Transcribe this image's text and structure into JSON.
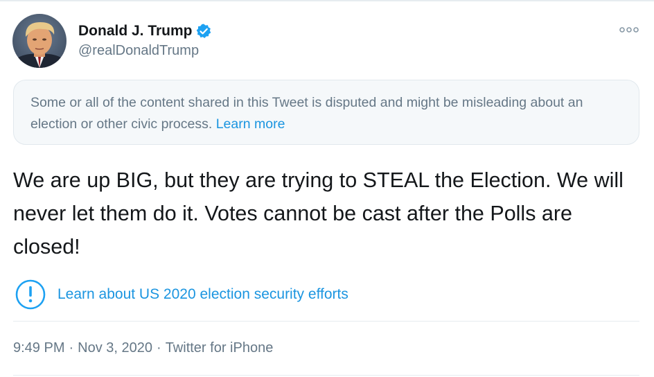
{
  "author": {
    "display_name": "Donald J. Trump",
    "handle": "@realDonaldTrump",
    "verified": true
  },
  "notice": {
    "text": "Some or all of the content shared in this Tweet is disputed and might be misleading about an election or other civic process.",
    "link_label": "Learn more"
  },
  "tweet": {
    "text": "We are up BIG, but they are trying to STEAL the Election. We will never let them do it. Votes cannot be cast after the Polls are closed!"
  },
  "election_prompt": {
    "label": "Learn about US 2020 election security efforts"
  },
  "meta": {
    "time": "9:49 PM",
    "date": "Nov 3, 2020",
    "source": "Twitter for iPhone",
    "separator": "·"
  },
  "colors": {
    "link": "#1b95e0",
    "verified": "#1da1f2",
    "secondary_text": "#657786",
    "notice_background": "#f5f8fa"
  },
  "icons": {
    "verified": "verified-badge-icon",
    "more": "more-options-icon",
    "alert": "exclamation-circle-icon"
  }
}
